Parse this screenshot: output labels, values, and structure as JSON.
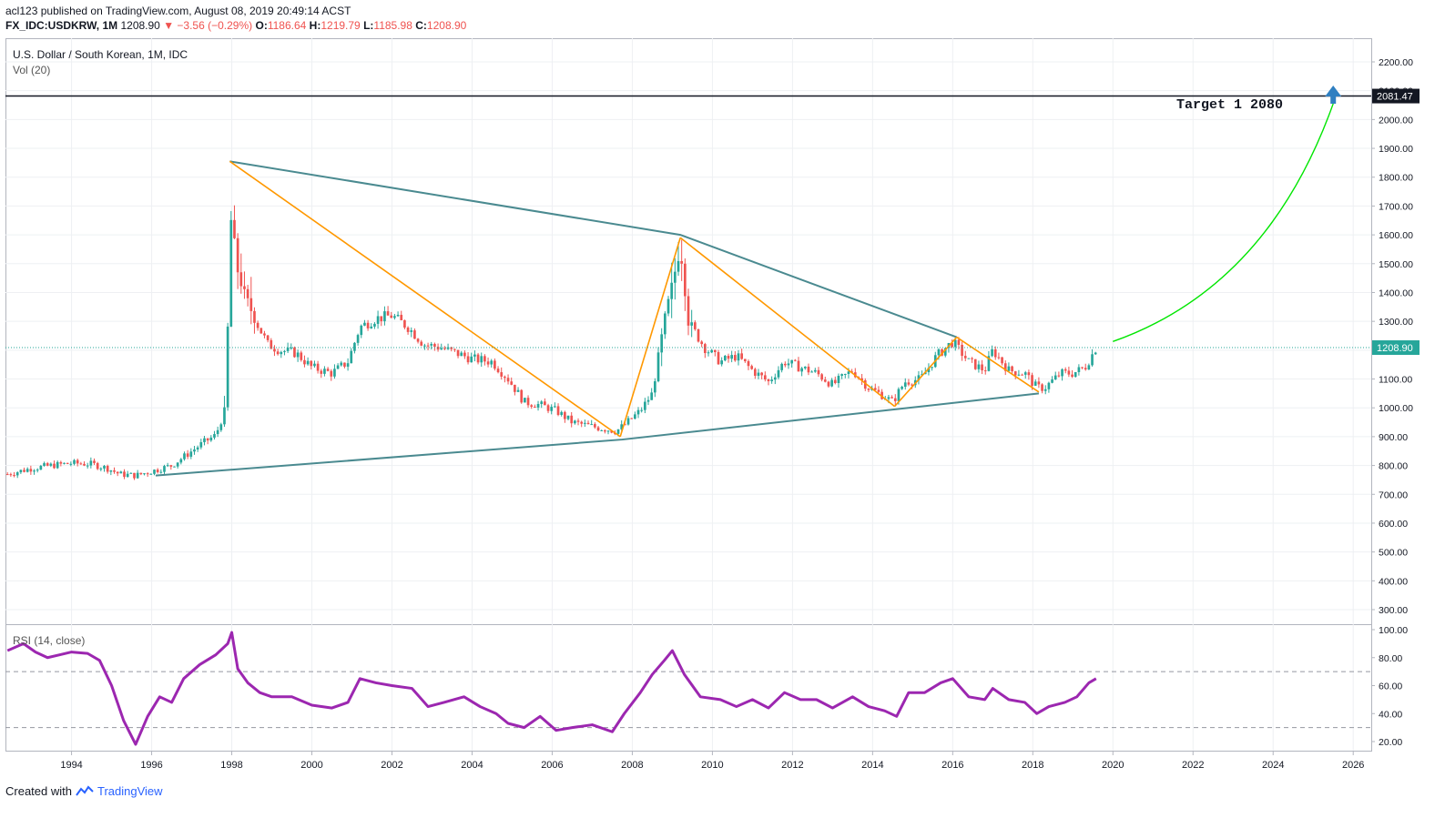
{
  "header": {
    "author": "acl123",
    "published_text": "published on TradingView.com, August 08, 2019 20:49:14 ACST",
    "symbol": "FX_IDC:USDKRW, 1M",
    "last_price": "1208.90",
    "change": "▼ −3.56 (−0.29%)",
    "o_label": "O:",
    "o_value": "1186.64",
    "h_label": "H:",
    "h_value": "1219.79",
    "l_label": "L:",
    "l_value": "1185.98",
    "c_label": "C:",
    "c_value": "1208.90"
  },
  "chart_legend": {
    "title": "U.S. Dollar / South Korean, 1M, IDC",
    "volume": "Vol (20)",
    "rsi": "RSI (14, close)"
  },
  "annotations": {
    "target_text": "Target 1 2080",
    "target_level_label": "2081.47",
    "current_price_label": "1208.90"
  },
  "footer": {
    "created_with": "Created with",
    "brand": "TradingView"
  },
  "colors": {
    "up": "#26a69a",
    "down": "#ef5350",
    "trendline": "#4a8a90",
    "wave": "#ff9800",
    "projection": "#00e600",
    "rsi": "#9c27b0",
    "arrow": "#2f7fc1",
    "price_line": "#26a69a"
  },
  "chart_data": {
    "type": "candlestick",
    "interval": "1M",
    "ylim": [
      250,
      2250
    ],
    "y_ticks": [
      "2200.00",
      "2100.00",
      "2000.00",
      "1900.00",
      "1800.00",
      "1700.00",
      "1600.00",
      "1500.00",
      "1400.00",
      "1300.00",
      "1200.00",
      "1100.00",
      "1000.00",
      "900.00",
      "800.00",
      "700.00",
      "600.00",
      "500.00",
      "400.00",
      "300.00"
    ],
    "x_ticks": [
      "1994",
      "1996",
      "1998",
      "2000",
      "2002",
      "2004",
      "2006",
      "2008",
      "2010",
      "2012",
      "2014",
      "2016",
      "2018",
      "2020",
      "2022",
      "2024",
      "2026"
    ],
    "price_path": [
      [
        1992.4,
        770
      ],
      [
        1993.0,
        790
      ],
      [
        1993.5,
        800
      ],
      [
        1994.0,
        808
      ],
      [
        1994.5,
        805
      ],
      [
        1994.9,
        790
      ],
      [
        1995.2,
        770
      ],
      [
        1995.6,
        765
      ],
      [
        1996.0,
        780
      ],
      [
        1996.5,
        800
      ],
      [
        1996.9,
        840
      ],
      [
        1997.3,
        880
      ],
      [
        1997.6,
        905
      ],
      [
        1997.85,
        1000
      ],
      [
        1997.95,
        1550
      ],
      [
        1998.0,
        1700
      ],
      [
        1998.1,
        1500
      ],
      [
        1998.3,
        1400
      ],
      [
        1998.6,
        1300
      ],
      [
        1998.9,
        1220
      ],
      [
        1999.2,
        1200
      ],
      [
        1999.6,
        1190
      ],
      [
        2000.0,
        1140
      ],
      [
        2000.5,
        1120
      ],
      [
        2000.9,
        1160
      ],
      [
        2001.2,
        1280
      ],
      [
        2001.6,
        1310
      ],
      [
        2002.0,
        1320
      ],
      [
        2002.4,
        1280
      ],
      [
        2002.8,
        1220
      ],
      [
        2003.2,
        1210
      ],
      [
        2003.6,
        1190
      ],
      [
        2004.0,
        1170
      ],
      [
        2004.5,
        1160
      ],
      [
        2004.9,
        1100
      ],
      [
        2005.3,
        1020
      ],
      [
        2005.7,
        1010
      ],
      [
        2006.1,
        990
      ],
      [
        2006.5,
        950
      ],
      [
        2007.0,
        935
      ],
      [
        2007.6,
        920
      ],
      [
        2007.8,
        940
      ],
      [
        2008.2,
        990
      ],
      [
        2008.5,
        1050
      ],
      [
        2008.8,
        1300
      ],
      [
        2009.0,
        1430
      ],
      [
        2009.2,
        1560
      ],
      [
        2009.4,
        1300
      ],
      [
        2009.8,
        1210
      ],
      [
        2010.2,
        1160
      ],
      [
        2010.6,
        1180
      ],
      [
        2011.0,
        1130
      ],
      [
        2011.4,
        1090
      ],
      [
        2011.8,
        1160
      ],
      [
        2012.2,
        1140
      ],
      [
        2012.6,
        1120
      ],
      [
        2013.0,
        1080
      ],
      [
        2013.5,
        1130
      ],
      [
        2013.9,
        1070
      ],
      [
        2014.3,
        1040
      ],
      [
        2014.5,
        1020
      ],
      [
        2014.8,
        1090
      ],
      [
        2015.2,
        1100
      ],
      [
        2015.6,
        1180
      ],
      [
        2016.0,
        1230
      ],
      [
        2016.4,
        1160
      ],
      [
        2016.8,
        1130
      ],
      [
        2017.0,
        1200
      ],
      [
        2017.4,
        1130
      ],
      [
        2017.8,
        1120
      ],
      [
        2018.1,
        1070
      ],
      [
        2018.3,
        1070
      ],
      [
        2018.7,
        1120
      ],
      [
        2019.0,
        1120
      ],
      [
        2019.3,
        1140
      ],
      [
        2019.58,
        1208.9
      ]
    ],
    "trendlines": [
      {
        "name": "upper",
        "points": [
          [
            1997.95,
            1855
          ],
          [
            2009.2,
            1600
          ],
          [
            2016.1,
            1245
          ]
        ]
      },
      {
        "name": "lower",
        "points": [
          [
            1996.1,
            765
          ],
          [
            2007.75,
            890
          ],
          [
            2018.15,
            1050
          ]
        ]
      }
    ],
    "wave_lines": [
      [
        [
          1997.95,
          1855
        ],
        [
          2007.7,
          900
        ]
      ],
      [
        [
          2007.7,
          900
        ],
        [
          2009.2,
          1590
        ]
      ],
      [
        [
          2009.2,
          1590
        ],
        [
          2014.55,
          1005
        ]
      ],
      [
        [
          2014.55,
          1005
        ],
        [
          2016.1,
          1245
        ]
      ],
      [
        [
          2016.1,
          1245
        ],
        [
          2018.15,
          1055
        ]
      ]
    ],
    "projection_curve": {
      "from": [
        2020.0,
        1230
      ],
      "to": [
        2025.5,
        2055
      ]
    },
    "horizontal_levels": [
      {
        "value": 2081.47,
        "label": "2081.47"
      },
      {
        "value": 1208.9,
        "label": "1208.90",
        "style": "dotted"
      }
    ],
    "rsi": {
      "ylim": [
        10,
        104
      ],
      "y_ticks": [
        "100.00",
        "80.00",
        "60.00",
        "40.00",
        "20.00"
      ],
      "bands": [
        70,
        30
      ],
      "path": [
        [
          1992.4,
          85
        ],
        [
          1992.8,
          90
        ],
        [
          1993.1,
          84
        ],
        [
          1993.4,
          80
        ],
        [
          1993.7,
          82
        ],
        [
          1994.0,
          84
        ],
        [
          1994.4,
          83
        ],
        [
          1994.7,
          78
        ],
        [
          1995.0,
          60
        ],
        [
          1995.3,
          35
        ],
        [
          1995.6,
          18
        ],
        [
          1995.9,
          38
        ],
        [
          1996.2,
          52
        ],
        [
          1996.5,
          48
        ],
        [
          1996.8,
          65
        ],
        [
          1997.2,
          75
        ],
        [
          1997.6,
          82
        ],
        [
          1997.9,
          90
        ],
        [
          1998.0,
          98
        ],
        [
          1998.15,
          72
        ],
        [
          1998.4,
          62
        ],
        [
          1998.7,
          55
        ],
        [
          1999.0,
          52
        ],
        [
          1999.5,
          52
        ],
        [
          2000.0,
          46
        ],
        [
          2000.5,
          44
        ],
        [
          2000.9,
          48
        ],
        [
          2001.2,
          65
        ],
        [
          2001.6,
          62
        ],
        [
          2002.0,
          60
        ],
        [
          2002.5,
          58
        ],
        [
          2002.9,
          45
        ],
        [
          2003.3,
          48
        ],
        [
          2003.8,
          52
        ],
        [
          2004.2,
          45
        ],
        [
          2004.6,
          40
        ],
        [
          2004.9,
          33
        ],
        [
          2005.3,
          30
        ],
        [
          2005.7,
          38
        ],
        [
          2006.1,
          28
        ],
        [
          2006.5,
          30
        ],
        [
          2007.0,
          32
        ],
        [
          2007.5,
          27
        ],
        [
          2007.8,
          40
        ],
        [
          2008.2,
          55
        ],
        [
          2008.5,
          68
        ],
        [
          2008.8,
          78
        ],
        [
          2009.0,
          85
        ],
        [
          2009.3,
          68
        ],
        [
          2009.7,
          52
        ],
        [
          2010.2,
          50
        ],
        [
          2010.6,
          45
        ],
        [
          2011.0,
          50
        ],
        [
          2011.4,
          44
        ],
        [
          2011.8,
          55
        ],
        [
          2012.2,
          50
        ],
        [
          2012.6,
          50
        ],
        [
          2013.0,
          44
        ],
        [
          2013.5,
          52
        ],
        [
          2013.9,
          45
        ],
        [
          2014.3,
          42
        ],
        [
          2014.6,
          38
        ],
        [
          2014.9,
          55
        ],
        [
          2015.3,
          55
        ],
        [
          2015.7,
          62
        ],
        [
          2016.0,
          65
        ],
        [
          2016.4,
          52
        ],
        [
          2016.8,
          50
        ],
        [
          2017.0,
          58
        ],
        [
          2017.4,
          50
        ],
        [
          2017.8,
          48
        ],
        [
          2018.1,
          40
        ],
        [
          2018.4,
          45
        ],
        [
          2018.8,
          48
        ],
        [
          2019.1,
          52
        ],
        [
          2019.4,
          62
        ],
        [
          2019.58,
          65
        ]
      ]
    }
  }
}
